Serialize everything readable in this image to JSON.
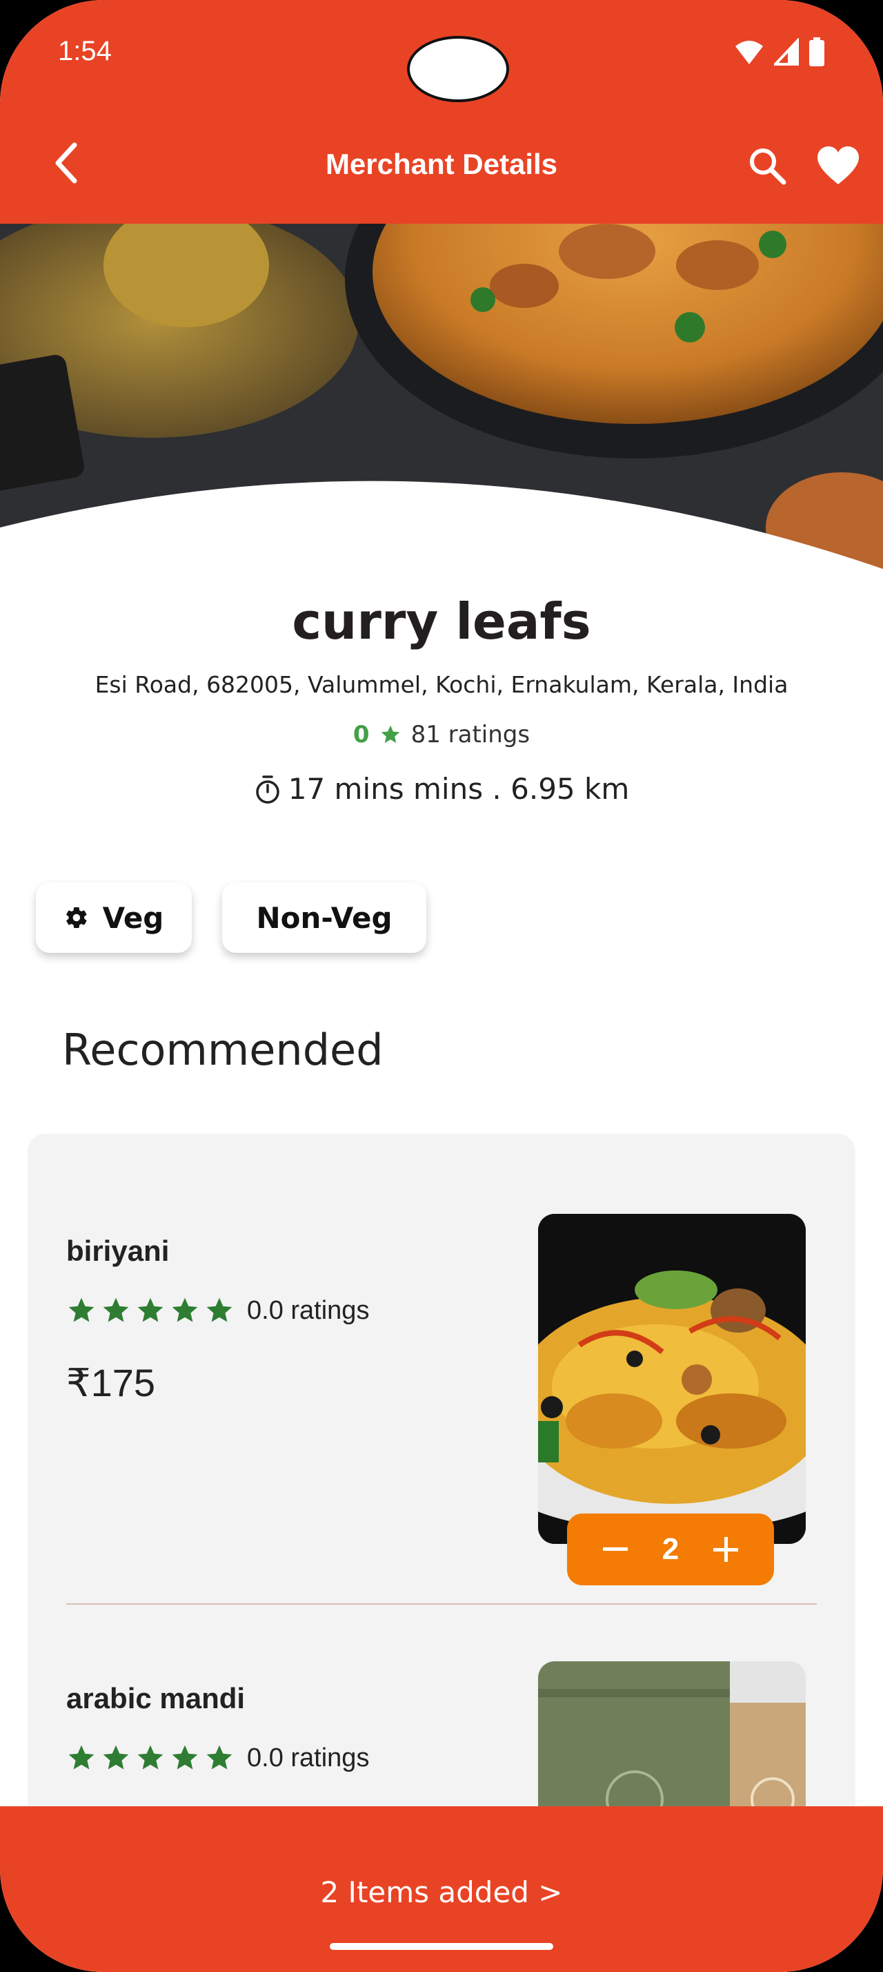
{
  "status_bar": {
    "time": "1:54"
  },
  "app_bar": {
    "title": "Merchant Details",
    "back_icon": "arrow-back-icon",
    "search_icon": "search-icon",
    "favorite_icon": "heart-icon"
  },
  "merchant": {
    "name": "curry leafs",
    "address": "Esi Road, 682005, Valummel, Kochi, Ernakulam, Kerala, India",
    "rating_value": "0",
    "ratings_count": "81 ratings",
    "eta": "17 mins mins . 6.95 km"
  },
  "filters": [
    {
      "label": "Veg",
      "icon": "gear-icon"
    },
    {
      "label": "Non-Veg"
    }
  ],
  "section": {
    "title": "Recommended"
  },
  "items": [
    {
      "name": "biriyani",
      "rating": 0.0,
      "ratings_text": "0.0 ratings",
      "price": "₹175",
      "quantity": "2"
    },
    {
      "name": "arabic mandi",
      "rating": 0.0,
      "ratings_text": "0.0 ratings"
    }
  ],
  "cart": {
    "label": "2 Items added >"
  },
  "colors": {
    "primary": "#e94325",
    "stepper": "#f47c05",
    "star": "#2e7d32",
    "rating_value": "#43a047"
  }
}
